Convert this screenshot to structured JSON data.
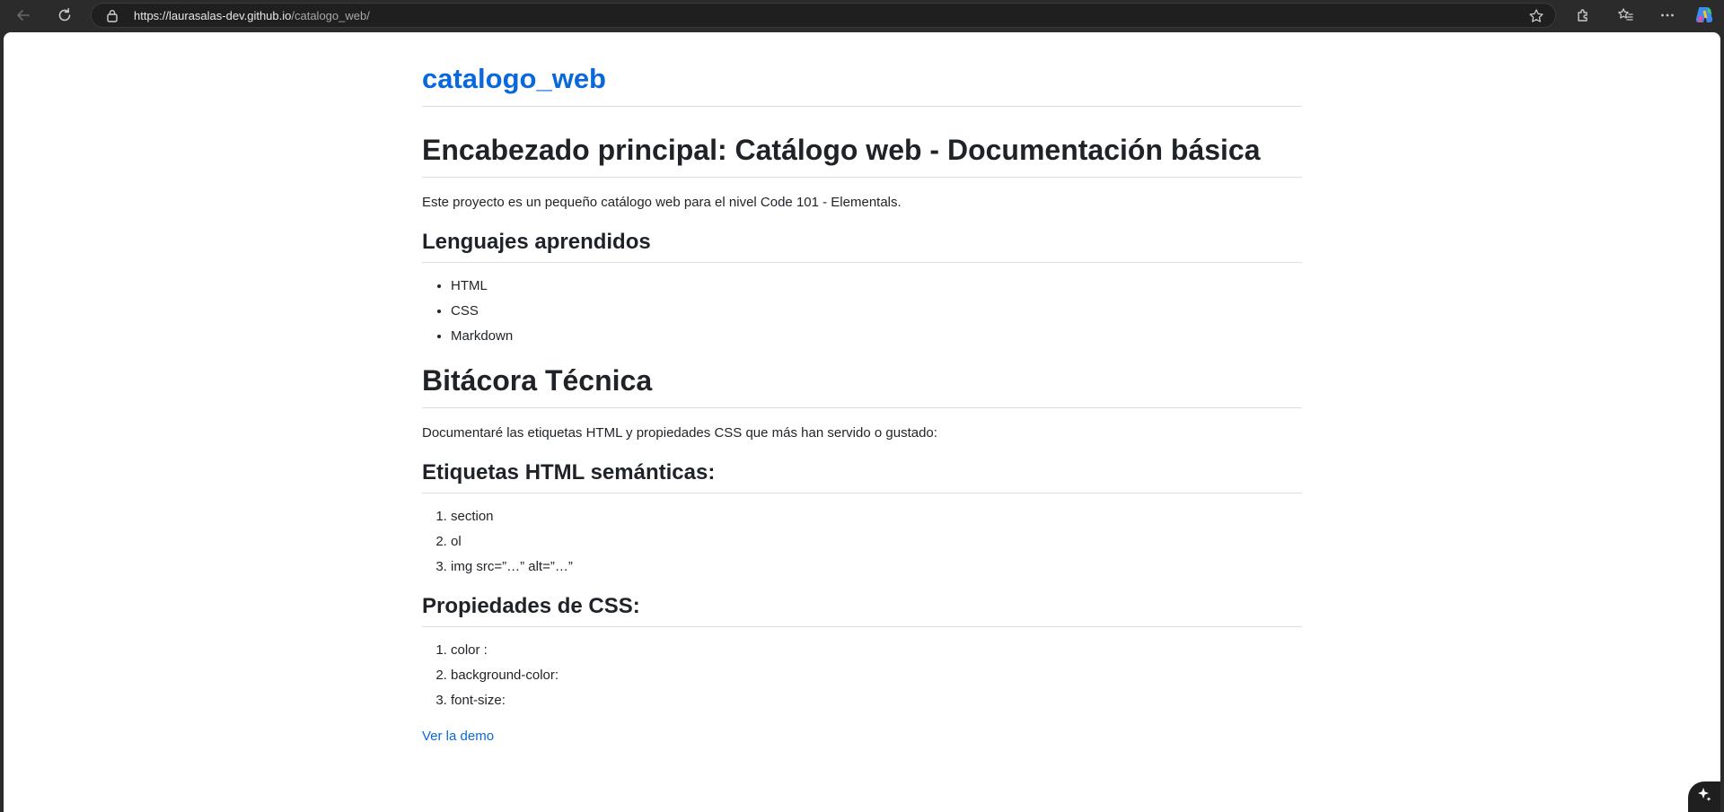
{
  "browser": {
    "url_host": "https://laurasalas-dev.github.io",
    "url_path": "/catalogo_web/"
  },
  "page": {
    "site_title": "catalogo_web",
    "heading_main": "Encabezado principal: Catálogo web - Documentación básica",
    "intro": "Este proyecto es un pequeño catálogo web para el nivel Code 101 - Elementals.",
    "section_languages": {
      "title": "Lenguajes aprendidos",
      "items": [
        "HTML",
        "CSS",
        "Markdown"
      ]
    },
    "heading_log": "Bitácora Técnica",
    "log_intro": "Documentaré las etiquetas HTML y propiedades CSS que más han servido o gustado:",
    "section_html": {
      "title": "Etiquetas HTML semánticas:",
      "items": [
        "section",
        "ol",
        "img src=”…” alt=”…”"
      ]
    },
    "section_css": {
      "title": "Propiedades de CSS:",
      "items": [
        "color :",
        "background-color:",
        "font-size:"
      ]
    },
    "demo_link": "Ver la demo"
  },
  "colors": {
    "link": "#0969da",
    "text": "#1f2328",
    "chrome": "#2b2b2b"
  },
  "icons": [
    "back-arrow-icon",
    "refresh-icon",
    "lock-icon",
    "favorite-star-icon",
    "extensions-icon",
    "favorites-icon",
    "more-icon",
    "copilot-icon",
    "sparkle-icon"
  ]
}
